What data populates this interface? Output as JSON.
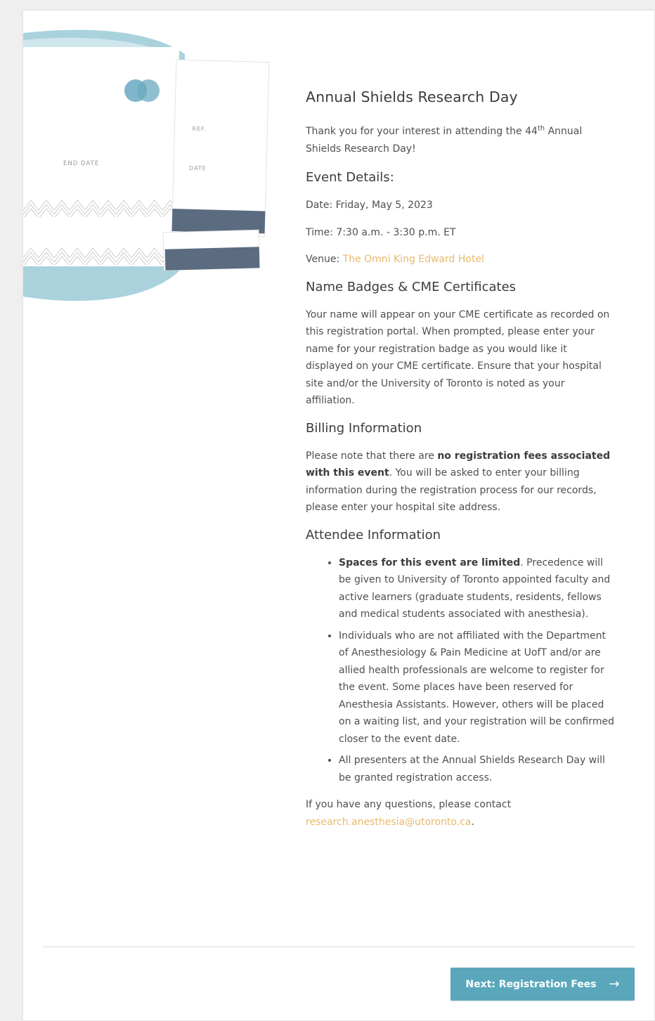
{
  "title": "Annual Shields Research Day",
  "intro": {
    "before": "Thank you for your interest in attending the 44",
    "sup": "th",
    "after": " Annual Shields Research Day!"
  },
  "event_details": {
    "heading": "Event Details:",
    "date": "Date: Friday, May 5, 2023",
    "time": "Time: 7:30 a.m. - 3:30 p.m. ET",
    "venue_label": "Venue: ",
    "venue_link": "The Omni King Edward Hotel"
  },
  "badges": {
    "heading": "Name Badges & CME Certificates",
    "text": "Your name will appear on your CME certificate as recorded on this registration portal. When prompted, please enter your name for your registration badge as you would like it displayed on your CME certificate. Ensure that  your hospital site and/or the University of Toronto is noted as your affiliation."
  },
  "billing": {
    "heading": "Billing Information",
    "before": "Please note that there are ",
    "bold": "no registration fees associated with this event",
    "after": ". You will be asked to enter your billing information during the registration process for our records, please enter your hospital site address."
  },
  "attendee": {
    "heading": "Attendee Information",
    "items": [
      {
        "bold": "Spaces for this event are limited",
        "text": ". Precedence will be given to University of Toronto appointed faculty and active learners (graduate students, residents, fellows and medical students associated with anesthesia)."
      },
      {
        "bold": "",
        "text": "Individuals who are not affiliated with the Department of Anesthesiology & Pain Medicine at UofT and/or are allied health professionals are welcome to register for the event. Some places have been reserved for Anesthesia Assistants. However, others will be placed on a waiting list, and your registration will be confirmed closer to the event date."
      },
      {
        "bold": "",
        "text": "All presenters at the Annual Shields Research Day will be granted registration access."
      }
    ]
  },
  "contact": {
    "before": "If you have any questions, please contact ",
    "email": "research.anesthesia@utoronto.ca",
    "after": "."
  },
  "ticket_labels": {
    "end_date": "END DATE",
    "ref": "REF.",
    "date": "DATE"
  },
  "next_button": {
    "label": "Next: Registration Fees",
    "arrow": "→"
  },
  "colors": {
    "accent_link": "#e8b96a",
    "button": "#5aa7bb",
    "illustration_blue": "#a9d2dd",
    "ticket_stub": "#5b6b80"
  }
}
